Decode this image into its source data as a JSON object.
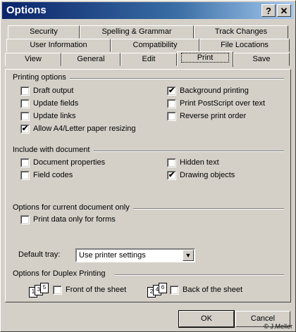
{
  "window": {
    "title": "Options",
    "help_glyph": "?",
    "close_glyph": "✕"
  },
  "tabs": {
    "row1": [
      "Security",
      "Spelling & Grammar",
      "Track Changes"
    ],
    "row2": [
      "User Information",
      "Compatibility",
      "File Locations"
    ],
    "row3": [
      "View",
      "General",
      "Edit",
      "Print",
      "Save"
    ],
    "active": "Print"
  },
  "printing_options": {
    "heading": "Printing options",
    "draft_output": {
      "label": "Draft output",
      "checked": false
    },
    "update_fields": {
      "label": "Update fields",
      "checked": false
    },
    "update_links": {
      "label": "Update links",
      "checked": false
    },
    "allow_resizing": {
      "label": "Allow A4/Letter paper resizing",
      "checked": true
    },
    "background_printing": {
      "label": "Background printing",
      "checked": true
    },
    "print_postscript": {
      "label": "Print PostScript over text",
      "checked": false
    },
    "reverse_order": {
      "label": "Reverse print order",
      "checked": false
    }
  },
  "include_with_document": {
    "heading": "Include with document",
    "document_properties": {
      "label": "Document properties",
      "checked": false
    },
    "field_codes": {
      "label": "Field codes",
      "checked": false
    },
    "hidden_text": {
      "label": "Hidden text",
      "checked": false
    },
    "drawing_objects": {
      "label": "Drawing objects",
      "checked": true
    }
  },
  "current_document": {
    "heading": "Options for current document only",
    "print_data_only": {
      "label": "Print data only for forms",
      "checked": false
    }
  },
  "default_tray": {
    "label": "Default tray:",
    "value": "Use printer settings"
  },
  "duplex": {
    "heading": "Options for Duplex Printing",
    "front": {
      "label": "Front of the sheet",
      "checked": false,
      "pages": [
        "1",
        "3",
        "5"
      ]
    },
    "back": {
      "label": "Back of the sheet",
      "checked": false,
      "pages": [
        "2",
        "4",
        "6"
      ]
    }
  },
  "buttons": {
    "ok": "OK",
    "cancel": "Cancel"
  },
  "copyright": "© J.Meller"
}
